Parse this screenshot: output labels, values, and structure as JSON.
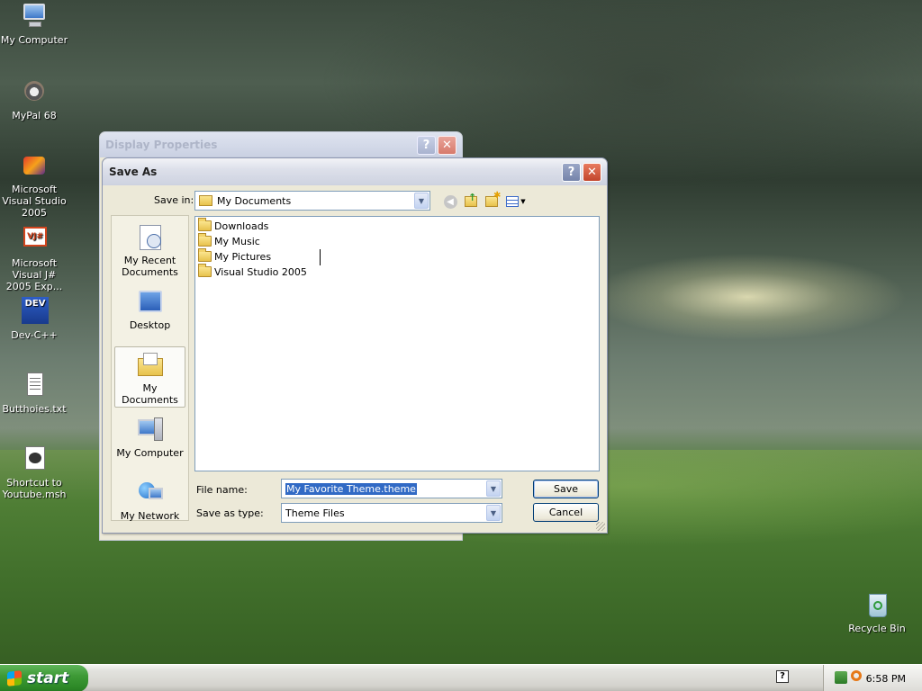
{
  "desktop": {
    "icons": [
      {
        "label": "My Computer",
        "icon": "my-computer-icon"
      },
      {
        "label": "MyPal 68",
        "icon": "mypal-icon"
      },
      {
        "label": "Microsoft Visual Studio 2005",
        "icon": "visual-studio-icon"
      },
      {
        "label": "Microsoft Visual J# 2005 Exp...",
        "icon": "vjsharp-icon"
      },
      {
        "label": "Dev-C++",
        "icon": "devcpp-icon"
      },
      {
        "label": "Butthoies.txt",
        "icon": "text-file-icon"
      },
      {
        "label": "Shortcut to Youtube.msh",
        "icon": "msh-script-icon"
      },
      {
        "label": "Recycle Bin",
        "icon": "recycle-bin-icon"
      }
    ]
  },
  "display_properties": {
    "title": "Display Properties",
    "help": "?",
    "close": "✕"
  },
  "save_as": {
    "title": "Save As",
    "help": "?",
    "close": "✕",
    "save_in_label": "Save in:",
    "save_in_value": "My Documents",
    "places": [
      {
        "label": "My Recent Documents",
        "icon": "recent-documents-icon"
      },
      {
        "label": "Desktop",
        "icon": "desktop-icon"
      },
      {
        "label": "My Documents",
        "icon": "my-documents-icon",
        "selected": true
      },
      {
        "label": "My Computer",
        "icon": "my-computer-icon"
      },
      {
        "label": "My Network",
        "icon": "my-network-icon"
      }
    ],
    "files": [
      {
        "name": "Downloads"
      },
      {
        "name": "My Music"
      },
      {
        "name": "My Pictures"
      },
      {
        "name": "Visual Studio 2005"
      }
    ],
    "file_name_label": "File name:",
    "file_name_value": "My Favorite Theme.theme",
    "save_as_type_label": "Save as type:",
    "save_as_type_value": "Theme Files",
    "save_button": "Save",
    "cancel_button": "Cancel"
  },
  "taskbar": {
    "start_label": "start",
    "clock": "6:58 PM"
  }
}
